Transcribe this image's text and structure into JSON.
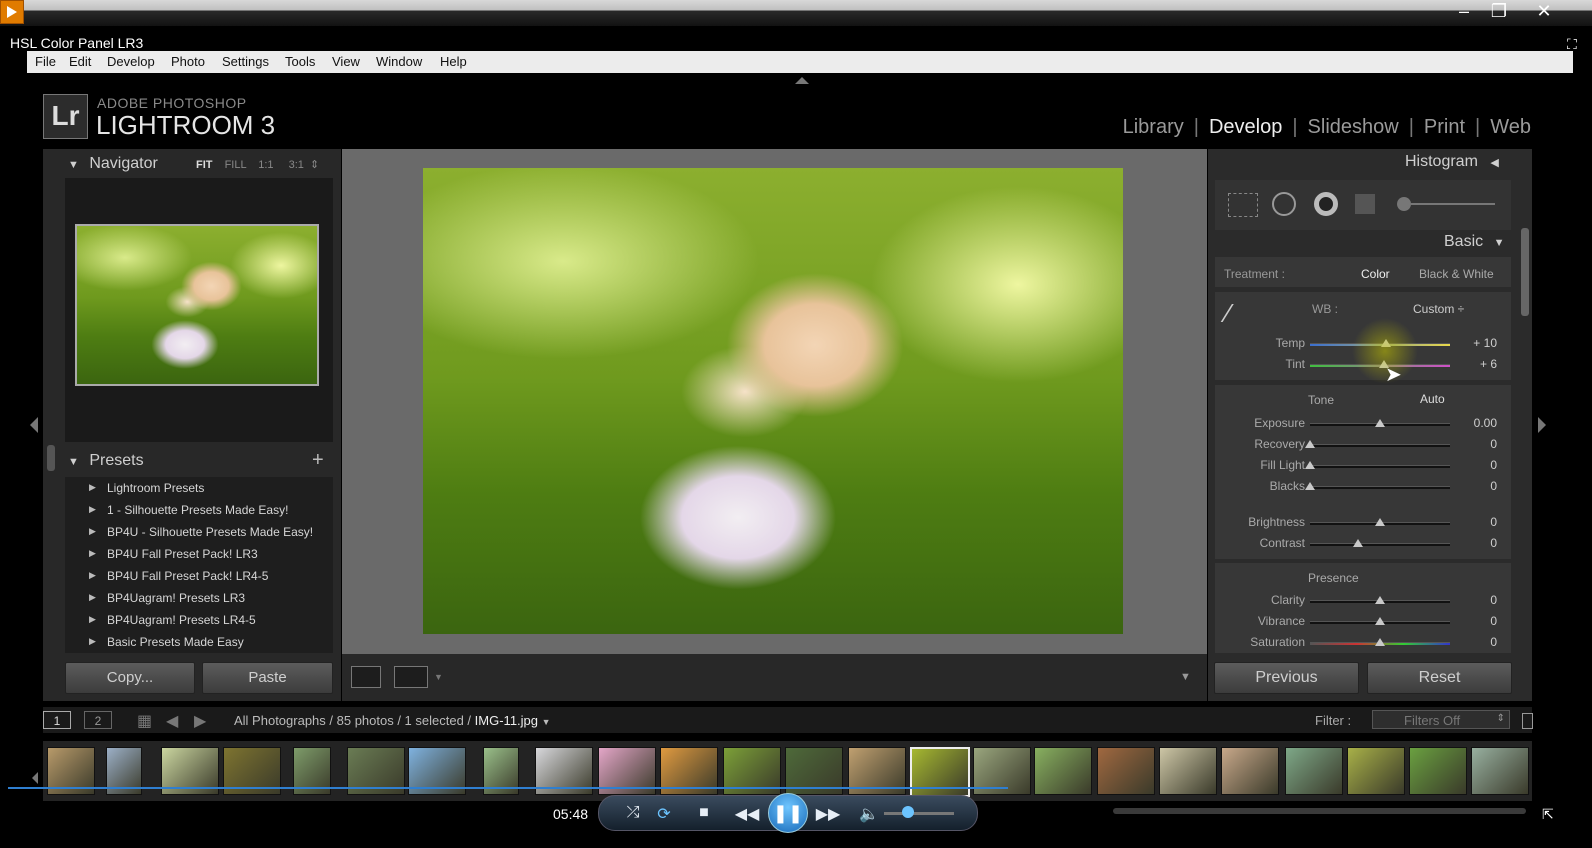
{
  "player": {
    "clip_title": "HSL Color Panel LR3",
    "time": "05:48",
    "icons": [
      "player-logo-icon",
      "minimize-icon",
      "restore-icon",
      "close-icon",
      "fullscreen-icon",
      "shuffle-icon",
      "repeat-icon",
      "stop-icon",
      "rewind-icon",
      "pause-icon",
      "fast-forward-icon",
      "volume-icon"
    ]
  },
  "menu": [
    "File",
    "Edit",
    "Develop",
    "Photo",
    "Settings",
    "Tools",
    "View",
    "Window",
    "Help"
  ],
  "identity": {
    "badge": "Lr",
    "line1": "ADOBE PHOTOSHOP",
    "line2": "LIGHTROOM 3"
  },
  "modules": [
    "Library",
    "Develop",
    "Slideshow",
    "Print",
    "Web"
  ],
  "navigator": {
    "title": "Navigator",
    "opts": [
      "FIT",
      "FILL",
      "1:1",
      "3:1"
    ]
  },
  "presets": {
    "title": "Presets",
    "items": [
      "Lightroom Presets",
      "1 - Silhouette Presets Made Easy!",
      "BP4U - Silhouette Presets Made Easy!",
      "BP4U Fall Preset Pack! LR3",
      "BP4U Fall Preset Pack! LR4-5",
      "BP4Uagram! Presets LR3",
      "BP4Uagram! Presets LR4-5",
      "Basic Presets Made Easy"
    ]
  },
  "left_buttons": {
    "copy": "Copy...",
    "paste": "Paste"
  },
  "right_panel": {
    "histogram": "Histogram",
    "basic": "Basic",
    "treatment_label": "Treatment :",
    "treatment_color": "Color",
    "treatment_bw": "Black & White",
    "wb_label": "WB :",
    "wb_value": "Custom ÷",
    "tone": "Tone",
    "auto": "Auto",
    "presence": "Presence",
    "sliders_wb": [
      {
        "label": "Temp",
        "value": "+ 10",
        "pos": 0.54
      },
      {
        "label": "Tint",
        "value": "+ 6",
        "pos": 0.53
      }
    ],
    "sliders_tone": [
      {
        "label": "Exposure",
        "value": "0.00",
        "pos": 0.5
      },
      {
        "label": "Recovery",
        "value": "0",
        "pos": 0.0
      },
      {
        "label": "Fill Light",
        "value": "0",
        "pos": 0.0
      },
      {
        "label": "Blacks",
        "value": "0",
        "pos": 0.0
      }
    ],
    "sliders_bc": [
      {
        "label": "Brightness",
        "value": "0",
        "pos": 0.5
      },
      {
        "label": "Contrast",
        "value": "0",
        "pos": 0.34
      }
    ],
    "sliders_presence": [
      {
        "label": "Clarity",
        "value": "0",
        "pos": 0.5
      },
      {
        "label": "Vibrance",
        "value": "0",
        "pos": 0.5
      },
      {
        "label": "Saturation",
        "value": "0",
        "pos": 0.5
      }
    ],
    "previous": "Previous",
    "reset": "Reset"
  },
  "filmstrip": {
    "page1": "1",
    "page2": "2",
    "source": "All Photographs / 85 photos / 1 selected /",
    "file": "IMG-11.jpg",
    "filter_label": "Filter :",
    "filter_value": "Filters Off"
  }
}
